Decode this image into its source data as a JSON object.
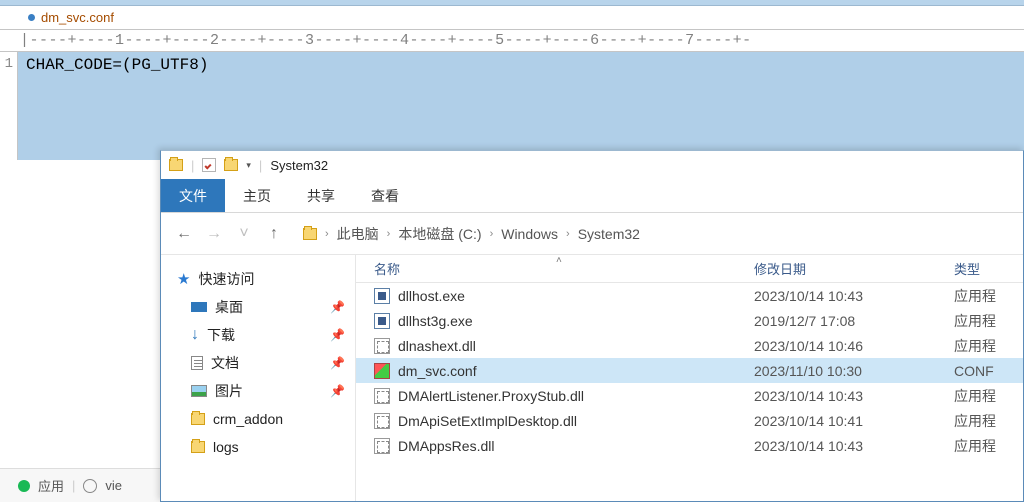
{
  "editor": {
    "tab_name": "dm_svc.conf",
    "ruler": "|----+----1----+----2----+----3----+----4----+----5----+----6----+----7----+-",
    "line_no": "1",
    "code": "CHAR_CODE=(PG_UTF8)"
  },
  "browser_frag": {
    "label1": "应用",
    "label2": "vie"
  },
  "explorer": {
    "title": "System32",
    "ribbon": {
      "file": "文件",
      "home": "主页",
      "share": "共享",
      "view": "查看"
    },
    "breadcrumbs": [
      "此电脑",
      "本地磁盘 (C:)",
      "Windows",
      "System32"
    ],
    "sidebar": {
      "quick": "快速访问",
      "desktop": "桌面",
      "downloads": "下载",
      "documents": "文档",
      "pictures": "图片",
      "crm": "crm_addon",
      "logs": "logs"
    },
    "columns": {
      "name": "名称",
      "date": "修改日期",
      "type": "类型"
    },
    "rows": [
      {
        "name": "dllhost.exe",
        "date": "2023/10/14 10:43",
        "type": "应用程",
        "kind": "exe",
        "selected": false
      },
      {
        "name": "dllhst3g.exe",
        "date": "2019/12/7 17:08",
        "type": "应用程",
        "kind": "exe",
        "selected": false
      },
      {
        "name": "dlnashext.dll",
        "date": "2023/10/14 10:46",
        "type": "应用程",
        "kind": "dll",
        "selected": false
      },
      {
        "name": "dm_svc.conf",
        "date": "2023/11/10 10:30",
        "type": "CONF",
        "kind": "conf",
        "selected": true
      },
      {
        "name": "DMAlertListener.ProxyStub.dll",
        "date": "2023/10/14 10:43",
        "type": "应用程",
        "kind": "dll",
        "selected": false
      },
      {
        "name": "DmApiSetExtImplDesktop.dll",
        "date": "2023/10/14 10:41",
        "type": "应用程",
        "kind": "dll",
        "selected": false
      },
      {
        "name": "DMAppsRes.dll",
        "date": "2023/10/14 10:43",
        "type": "应用程",
        "kind": "dll",
        "selected": false
      }
    ]
  }
}
